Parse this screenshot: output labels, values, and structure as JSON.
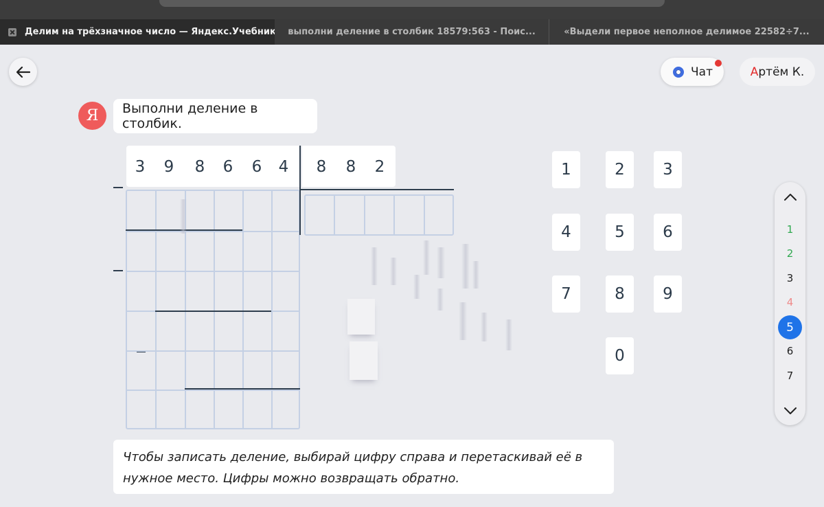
{
  "browser": {
    "tabs": [
      {
        "title": "Делим на трёхзначное число — Яндекс.Учебник",
        "active": true
      },
      {
        "title": "выполни деление в столбик 18579:563 - Поис...",
        "active": false
      },
      {
        "title": "«Выдели первое неполное делимое 22582÷7...",
        "active": false
      }
    ]
  },
  "header": {
    "chat_label": "Чат",
    "user_first_letter": "А",
    "user_rest": "ртём К."
  },
  "assistant": {
    "avatar_letter": "Я",
    "message": "Выполни деление в столбик."
  },
  "division": {
    "dividend_digits": [
      "3",
      "9",
      "8",
      "6",
      "6",
      "4"
    ],
    "divisor_digits": [
      "8",
      "8",
      "2"
    ]
  },
  "keypad": {
    "keys": [
      "1",
      "2",
      "3",
      "4",
      "5",
      "6",
      "7",
      "8",
      "9",
      "0"
    ]
  },
  "stepper": {
    "steps": [
      {
        "label": "1",
        "color": "#2fa84f"
      },
      {
        "label": "2",
        "color": "#2fa84f"
      },
      {
        "label": "3",
        "color": "#1f1f1f"
      },
      {
        "label": "4",
        "color": "#ef8a8a"
      },
      {
        "label": "5",
        "color": "#ffffff"
      },
      {
        "label": "6",
        "color": "#1f1f1f"
      },
      {
        "label": "7",
        "color": "#1f1f1f"
      }
    ],
    "current": "5"
  },
  "hint": {
    "line1": "Чтобы записать деление, выбирай цифру справа и перетаскивай её в",
    "line2": "нужное место. Цифры можно возвращать обратно."
  },
  "colors": {
    "accent": "#1f73e8",
    "brand_red": "#ef5b5b",
    "grid": "#c4d0e4"
  }
}
